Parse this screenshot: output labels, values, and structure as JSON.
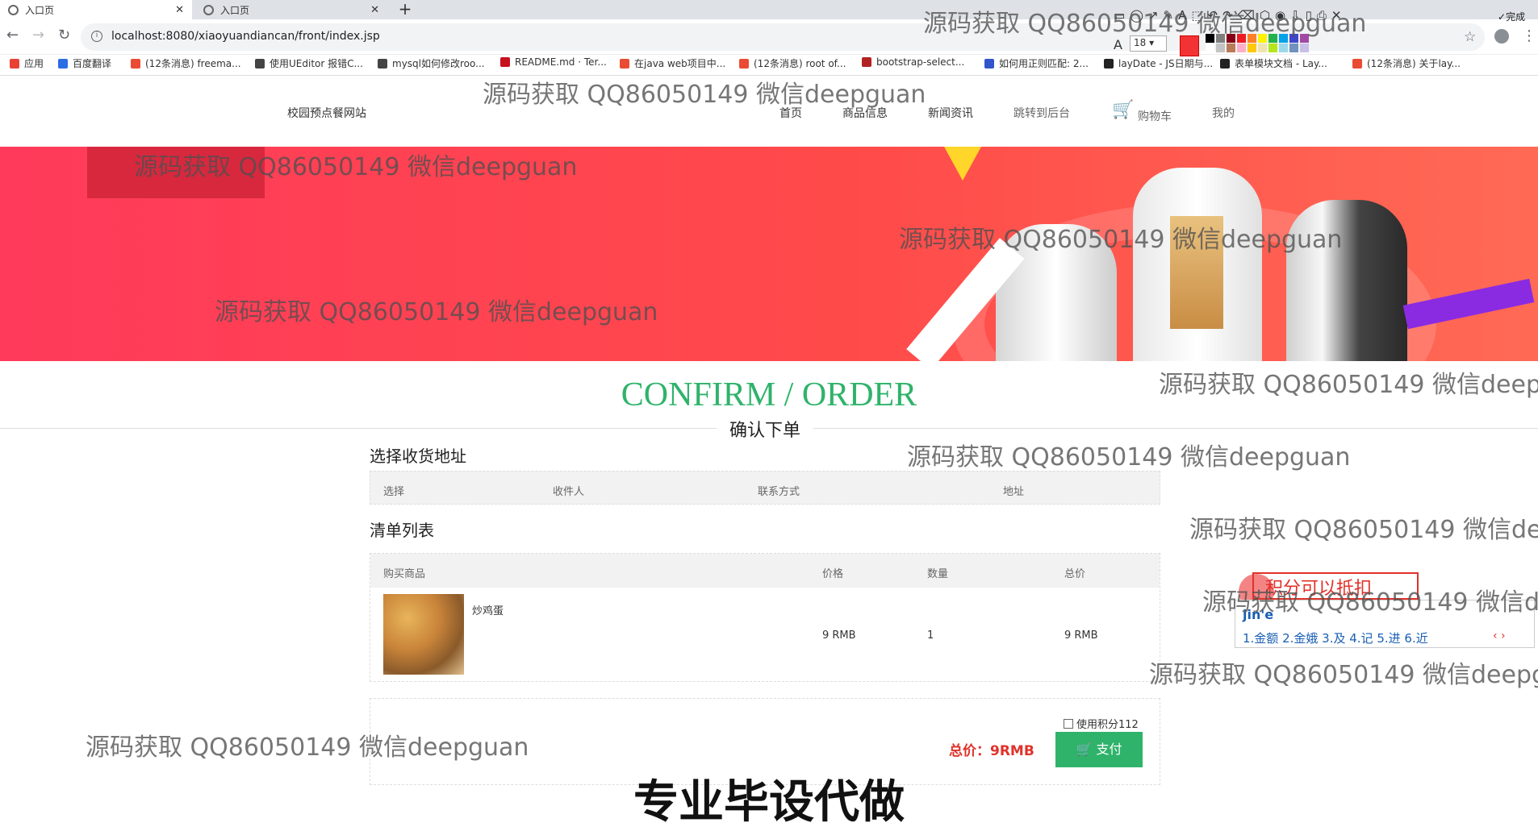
{
  "browser": {
    "tabs": [
      {
        "title": "入口页"
      },
      {
        "title": "入口页"
      }
    ],
    "new_tab": "+",
    "url": "localhost:8080/xiaoyuandiancan/front/index.jsp",
    "bookmarks": [
      {
        "label": "应用",
        "color": "#e94235"
      },
      {
        "label": "百度翻译",
        "color": "#2b6de5"
      },
      {
        "label": "(12条消息) freema...",
        "color": "#e94b35"
      },
      {
        "label": "使用UEditor 报错C...",
        "color": "#444444"
      },
      {
        "label": "mysql如何修改roo...",
        "color": "#444444"
      },
      {
        "label": "README.md · Ter...",
        "color": "#c7111e"
      },
      {
        "label": "在java web项目中...",
        "color": "#e94b35"
      },
      {
        "label": "(12条消息) root of...",
        "color": "#e94b35"
      },
      {
        "label": "bootstrap-select...",
        "color": "#b22222"
      },
      {
        "label": "如何用正则匹配: 2...",
        "color": "#3355cc"
      },
      {
        "label": "layDate - JS日期与...",
        "color": "#222222"
      },
      {
        "label": "表单模块文档 - Lay...",
        "color": "#222222"
      },
      {
        "label": "(12条消息) 关于lay...",
        "color": "#e94b35"
      }
    ]
  },
  "annotation_toolbar": {
    "font_size": "18",
    "done_label": "完成",
    "main_color": "#f33333",
    "palette": [
      "#000000",
      "#7f7f7f",
      "#880015",
      "#ed1c24",
      "#ff7f27",
      "#fff200",
      "#22b14c",
      "#00a2e8",
      "#3f48cc",
      "#a349a4",
      "#ffffff",
      "#c3c3c3",
      "#b97a57",
      "#ffaec9",
      "#ffc90e",
      "#efe4b0",
      "#b5e61d",
      "#99d9ea",
      "#7092be",
      "#c8bfe7"
    ]
  },
  "site": {
    "brand": "校园预点餐网站",
    "nav": [
      {
        "label": "首页"
      },
      {
        "label": "商品信息"
      },
      {
        "label": "新闻资讯"
      },
      {
        "label": "跳转到后台"
      },
      {
        "label": "购物车"
      },
      {
        "label": "我的"
      }
    ]
  },
  "page": {
    "confirm_title": "CONFIRM / ORDER",
    "confirm_subtitle": "确认下单",
    "address_section": "选择收货地址",
    "address_headers": [
      "选择",
      "收件人",
      "联系方式",
      "地址"
    ],
    "list_section": "清单列表",
    "list_headers": [
      "购买商品",
      "价格",
      "数量",
      "总价"
    ],
    "items": [
      {
        "name": "炒鸡蛋",
        "price": "9 RMB",
        "qty": "1",
        "total": "9 RMB"
      }
    ],
    "points_label": "使用积分112",
    "total_label": "总价：9RMB",
    "pay_label": "支付"
  },
  "ime": {
    "typed_text": "积分可以抵扣",
    "pinyin": "jin'e",
    "candidates": "1.金额  2.金娥  3.及  4.记  5.进  6.近"
  },
  "overlay": {
    "watermark": "源码获取 QQ86050149 微信deepguan",
    "bottom_banner": "专业毕设代做"
  }
}
